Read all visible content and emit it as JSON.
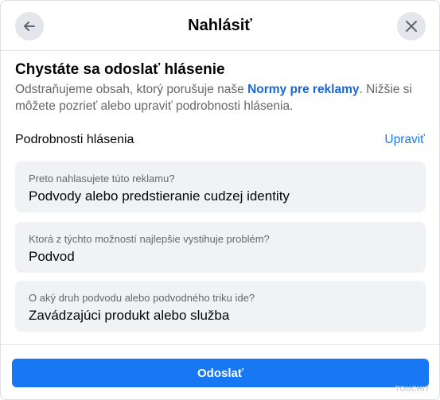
{
  "header": {
    "title": "Nahlásiť",
    "back_icon": "arrow-left-icon",
    "close_icon": "close-icon"
  },
  "intro": {
    "heading": "Chystáte sa odoslať hlásenie",
    "desc_before": "Odstraňujeme obsah, ktorý porušuje naše ",
    "desc_link": "Normy pre reklamy",
    "desc_after": ". Nižšie si môžete pozrieť alebo upraviť podrobnosti hlásenia."
  },
  "details": {
    "label": "Podrobnosti hlásenia",
    "edit": "Upraviť",
    "items": [
      {
        "question": "Preto nahlasujete túto reklamu?",
        "answer": "Podvody alebo predstieranie cudzej identity"
      },
      {
        "question": "Ktorá z týchto možností najlepšie vystihuje problém?",
        "answer": "Podvod"
      },
      {
        "question": "O aký druh podvodu alebo podvodného triku ide?",
        "answer": "Zavádzajúci produkt alebo služba"
      }
    ]
  },
  "footer": {
    "submit": "Odoslať"
  },
  "watermark": "TOUCHIT",
  "colors": {
    "accent": "#1877f2",
    "link": "#1866d8",
    "card_bg": "#f0f2f5",
    "muted_text": "#65676b"
  }
}
